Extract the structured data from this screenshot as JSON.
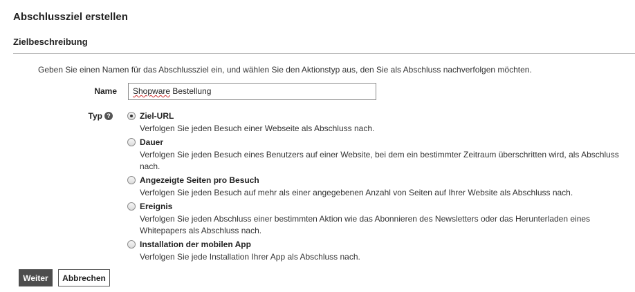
{
  "page": {
    "title": "Abschlussziel erstellen"
  },
  "section": {
    "title": "Zielbeschreibung",
    "intro": "Geben Sie einen Namen für das Abschlussziel ein, und wählen Sie den Aktionstyp aus, den Sie als Abschluss nachverfolgen möchten."
  },
  "form": {
    "name_label": "Name",
    "name_value_word1": "Shopware",
    "name_value_rest": " Bestellung",
    "type_label": "Typ",
    "help_glyph": "?",
    "options": [
      {
        "title": "Ziel-URL",
        "description": "Verfolgen Sie jeden Besuch einer Webseite als Abschluss nach.",
        "selected": true
      },
      {
        "title": "Dauer",
        "description": "Verfolgen Sie jeden Besuch eines Benutzers auf einer Website, bei dem ein bestimmter Zeitraum überschritten wird, als Abschluss nach.",
        "selected": false
      },
      {
        "title": "Angezeigte Seiten pro Besuch",
        "description": "Verfolgen Sie jeden Besuch auf mehr als einer angegebenen Anzahl von Seiten auf Ihrer Website als Abschluss nach.",
        "selected": false
      },
      {
        "title": "Ereignis",
        "description": "Verfolgen Sie jeden Abschluss einer bestimmten Aktion wie das Abonnieren des Newsletters oder das Herunterladen eines Whitepapers als Abschluss nach.",
        "selected": false
      },
      {
        "title": "Installation der mobilen App",
        "description": "Verfolgen Sie jede Installation Ihrer App als Abschluss nach.",
        "selected": false
      }
    ]
  },
  "buttons": {
    "next": "Weiter",
    "cancel": "Abbrechen"
  },
  "colors": {
    "primary_button": "#4d4d4d",
    "rule": "#bfbfbf",
    "spellcheck": "#d03030"
  }
}
